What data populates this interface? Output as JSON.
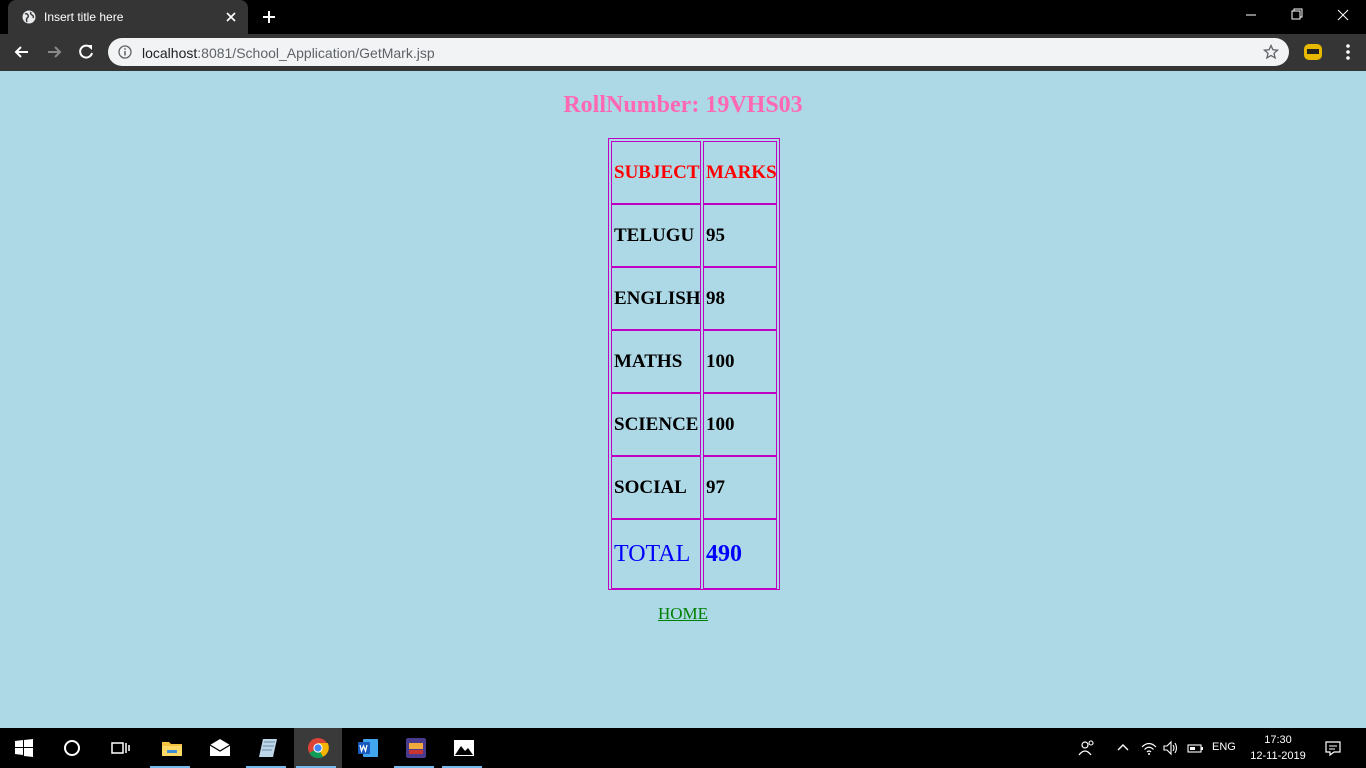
{
  "browser": {
    "tab_title": "Insert title here",
    "url_host": "localhost",
    "url_path": ":8081/School_Application/GetMark.jsp"
  },
  "page": {
    "heading_label": "RollNumber:",
    "roll_number": "19VHS03",
    "table": {
      "headers": [
        "SUBJECT",
        "MARKS"
      ],
      "rows": [
        {
          "subject": "TELUGU",
          "marks": "95"
        },
        {
          "subject": "ENGLISH",
          "marks": "98"
        },
        {
          "subject": "MATHS",
          "marks": "100"
        },
        {
          "subject": "SCIENCE",
          "marks": "100"
        },
        {
          "subject": "SOCIAL",
          "marks": "97"
        }
      ],
      "total_label": "TOTAL",
      "total_value": "490"
    },
    "home_link": "HOME",
    "colors": {
      "background": "#add8e6",
      "heading": "#ff69b4",
      "header_text": "#ff0000",
      "total_text": "#0000ff",
      "link": "#008000",
      "border": "#c000c0"
    }
  },
  "taskbar": {
    "language": "ENG",
    "time": "17:30",
    "date": "12-11-2019",
    "apps": [
      "start-icon",
      "cortana-icon",
      "task-view-icon",
      "file-explorer-icon",
      "mail-icon",
      "notes-icon",
      "chrome-icon",
      "word-icon",
      "game-icon",
      "photos-icon"
    ]
  }
}
